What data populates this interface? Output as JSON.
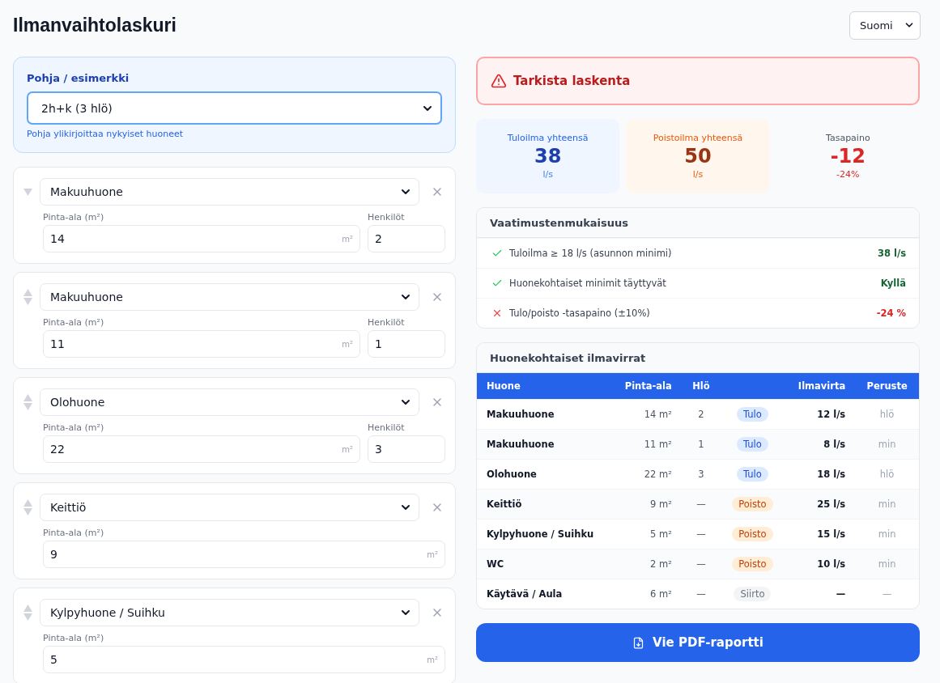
{
  "title": "Ilmanvaihtolaskuri",
  "language": {
    "value": "Suomi"
  },
  "template": {
    "label": "Pohja / esimerkki",
    "value": "2h+k (3 hlö)",
    "hint": "Pohja ylikirjoittaa nykyiset huoneet"
  },
  "rooms": [
    {
      "type": "Makuuhuone",
      "can_move_up": false,
      "area_label": "Pinta-ala (m²)",
      "area": "14",
      "unit": "m²",
      "persons_label": "Henkilöt",
      "persons": "2"
    },
    {
      "type": "Makuuhuone",
      "can_move_up": true,
      "area_label": "Pinta-ala (m²)",
      "area": "11",
      "unit": "m²",
      "persons_label": "Henkilöt",
      "persons": "1"
    },
    {
      "type": "Olohuone",
      "can_move_up": true,
      "area_label": "Pinta-ala (m²)",
      "area": "22",
      "unit": "m²",
      "persons_label": "Henkilöt",
      "persons": "3"
    },
    {
      "type": "Keittiö",
      "can_move_up": true,
      "area_label": "Pinta-ala (m²)",
      "area": "9",
      "unit": "m²"
    },
    {
      "type": "Kylpyhuone / Suihku",
      "can_move_up": true,
      "area_label": "Pinta-ala (m²)",
      "area": "5",
      "unit": "m²"
    }
  ],
  "alert": {
    "text": "Tarkista laskenta"
  },
  "totals": [
    {
      "kind": "supply",
      "label": "Tuloilma yhteensä",
      "value": "38",
      "unit": "l/s"
    },
    {
      "kind": "exhaust",
      "label": "Poistoilma yhteensä",
      "value": "50",
      "unit": "l/s"
    },
    {
      "kind": "balance",
      "label": "Tasapaino",
      "value": "-12",
      "unit": "-24%"
    }
  ],
  "compliance": {
    "title": "Vaatimustenmukaisuus",
    "rows": [
      {
        "ok": true,
        "text": "Tuloilma ≥ 18 l/s (asunnon minimi)",
        "result": "38 l/s"
      },
      {
        "ok": true,
        "text": "Huonekohtaiset minimit täyttyvät",
        "result": "Kyllä"
      },
      {
        "ok": false,
        "text": "Tulo/poisto -tasapaino (±10%)",
        "result": "-24 %"
      }
    ]
  },
  "flows": {
    "title": "Huonekohtaiset ilmavirrat",
    "columns": [
      "Huone",
      "Pinta-ala",
      "Hlö",
      "Ilmavirta",
      "Peruste"
    ],
    "rows": [
      {
        "room": "Makuuhuone",
        "area": "14 m²",
        "persons": "2",
        "kind": "supply",
        "type": "Tulo",
        "flow": "12 l/s",
        "basis": "hlö"
      },
      {
        "room": "Makuuhuone",
        "area": "11 m²",
        "persons": "1",
        "kind": "supply",
        "type": "Tulo",
        "flow": "8 l/s",
        "basis": "min"
      },
      {
        "room": "Olohuone",
        "area": "22 m²",
        "persons": "3",
        "kind": "supply",
        "type": "Tulo",
        "flow": "18 l/s",
        "basis": "hlö"
      },
      {
        "room": "Keittiö",
        "area": "9 m²",
        "persons": "—",
        "kind": "exhaust",
        "type": "Poisto",
        "flow": "25 l/s",
        "basis": "min"
      },
      {
        "room": "Kylpyhuone / Suihku",
        "area": "5 m²",
        "persons": "—",
        "kind": "exhaust",
        "type": "Poisto",
        "flow": "15 l/s",
        "basis": "min"
      },
      {
        "room": "WC",
        "area": "2 m²",
        "persons": "—",
        "kind": "exhaust",
        "type": "Poisto",
        "flow": "10 l/s",
        "basis": "min"
      },
      {
        "room": "Käytävä / Aula",
        "area": "6 m²",
        "persons": "—",
        "kind": "transfer",
        "type": "Siirto",
        "flow": "—",
        "basis": "—"
      }
    ]
  },
  "export_button": "Vie PDF-raportti"
}
